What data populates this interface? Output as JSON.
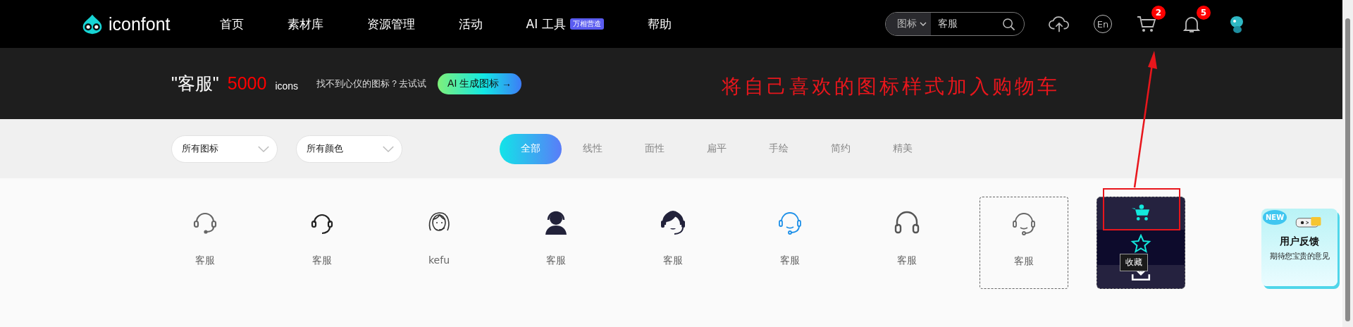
{
  "header": {
    "logo": "iconfont",
    "nav": [
      {
        "label": "首页"
      },
      {
        "label": "素材库"
      },
      {
        "label": "资源管理"
      },
      {
        "label": "活动"
      },
      {
        "label": "AI 工具",
        "badge": "万相营造"
      },
      {
        "label": "帮助"
      }
    ],
    "search": {
      "scope": "图标",
      "value": "客服"
    },
    "cart_count": "2",
    "notification_count": "5",
    "language": "En"
  },
  "banner": {
    "keyword": "\"客服\"",
    "count": "5000",
    "unit": "icons",
    "hint": "找不到心仪的图标？去试试",
    "button": "AI 生成图标 →"
  },
  "filters": {
    "dropdowns": [
      "所有图标",
      "所有颜色"
    ],
    "tabs": [
      {
        "label": "全部",
        "selected": true
      },
      {
        "label": "线性",
        "selected": false
      },
      {
        "label": "面性",
        "selected": false
      },
      {
        "label": "扁平",
        "selected": false
      },
      {
        "label": "手绘",
        "selected": false
      },
      {
        "label": "简约",
        "selected": false
      },
      {
        "label": "精美",
        "selected": false
      }
    ]
  },
  "icons": [
    {
      "kind": "headset_thin",
      "label": "客服",
      "color": "#666666",
      "outlined": false
    },
    {
      "kind": "headset",
      "label": "客服",
      "color": "#222222",
      "outlined": false
    },
    {
      "kind": "girl",
      "label": "kefu",
      "color": "#333333",
      "outlined": false
    },
    {
      "kind": "person",
      "label": "客服",
      "color": "#22223a",
      "outlined": false
    },
    {
      "kind": "woman_headset",
      "label": "客服",
      "color": "#22223a",
      "outlined": false
    },
    {
      "kind": "headset_smile",
      "label": "客服",
      "color": "#1e90e8",
      "outlined": false
    },
    {
      "kind": "headphones",
      "label": "客服",
      "color": "#555555",
      "outlined": false
    },
    {
      "kind": "headset_smile",
      "label": "客服",
      "color": "#666666",
      "outlined": true
    },
    {
      "kind": "hover_actions",
      "tooltip": "收藏"
    }
  ],
  "feedback": {
    "tag": "NEW",
    "title": "用户反馈",
    "subtitle": "期待您宝贵的意见"
  },
  "annotation": {
    "text": "将自己喜欢的图标样式加入购物车"
  }
}
